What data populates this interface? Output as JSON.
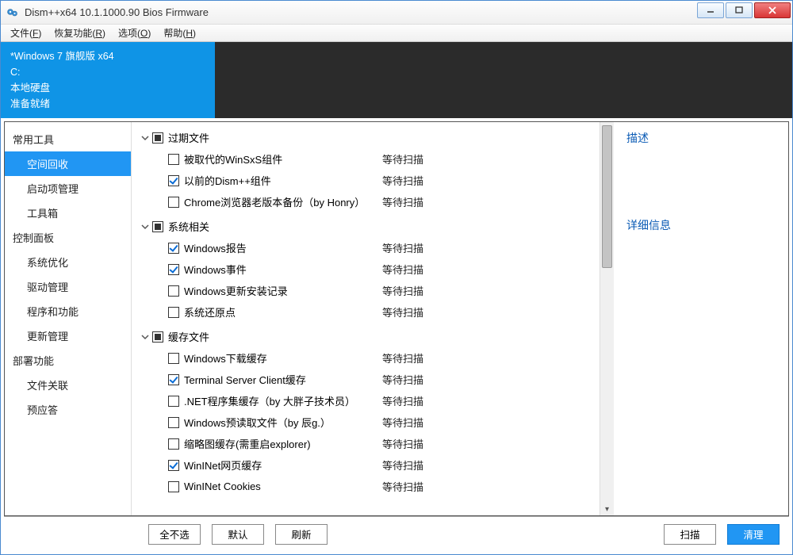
{
  "titlebar": {
    "title": "Dism++x64 10.1.1000.90 Bios Firmware"
  },
  "menubar": [
    {
      "label": "文件",
      "key": "F"
    },
    {
      "label": "恢复功能",
      "key": "R"
    },
    {
      "label": "选项",
      "key": "O"
    },
    {
      "label": "帮助",
      "key": "H"
    }
  ],
  "infobox": {
    "line1": "*Windows 7 旗舰版 x64",
    "line2": "C:",
    "line3": "本地硬盘",
    "line4": "准备就绪"
  },
  "sidebar": [
    {
      "header": "常用工具",
      "items": [
        {
          "label": "空间回收",
          "active": true
        },
        {
          "label": "启动项管理"
        },
        {
          "label": "工具箱"
        }
      ]
    },
    {
      "header": "控制面板",
      "items": [
        {
          "label": "系统优化"
        },
        {
          "label": "驱动管理"
        },
        {
          "label": "程序和功能"
        },
        {
          "label": "更新管理"
        }
      ]
    },
    {
      "header": "部署功能",
      "items": [
        {
          "label": "文件关联"
        },
        {
          "label": "预应答"
        }
      ]
    }
  ],
  "status_text": "等待扫描",
  "tree": [
    {
      "group": "过期文件",
      "state": "indeterminate",
      "items": [
        {
          "label": "被取代的WinSxS组件",
          "checked": false
        },
        {
          "label": "以前的Dism++组件",
          "checked": true
        },
        {
          "label": "Chrome浏览器老版本备份（by Honry）",
          "checked": false
        }
      ]
    },
    {
      "group": "系统相关",
      "state": "indeterminate",
      "items": [
        {
          "label": "Windows报告",
          "checked": true
        },
        {
          "label": "Windows事件",
          "checked": true
        },
        {
          "label": "Windows更新安装记录",
          "checked": false
        },
        {
          "label": "系统还原点",
          "checked": false
        }
      ]
    },
    {
      "group": "缓存文件",
      "state": "indeterminate",
      "items": [
        {
          "label": "Windows下载缓存",
          "checked": false
        },
        {
          "label": "Terminal Server Client缓存",
          "checked": true
        },
        {
          "label": ".NET程序集缓存（by 大胖子技术员）",
          "checked": false
        },
        {
          "label": "Windows预读取文件（by 辰g.）",
          "checked": false
        },
        {
          "label": "缩略图缓存(需重启explorer)",
          "checked": false
        },
        {
          "label": "WinINet网页缓存",
          "checked": true
        },
        {
          "label": "WinINet Cookies",
          "checked": false
        }
      ]
    }
  ],
  "right": {
    "desc_heading": "描述",
    "detail_heading": "详细信息"
  },
  "buttons": {
    "deselect_all": "全不选",
    "default": "默认",
    "refresh": "刷新",
    "scan": "扫描",
    "clean": "清理"
  }
}
